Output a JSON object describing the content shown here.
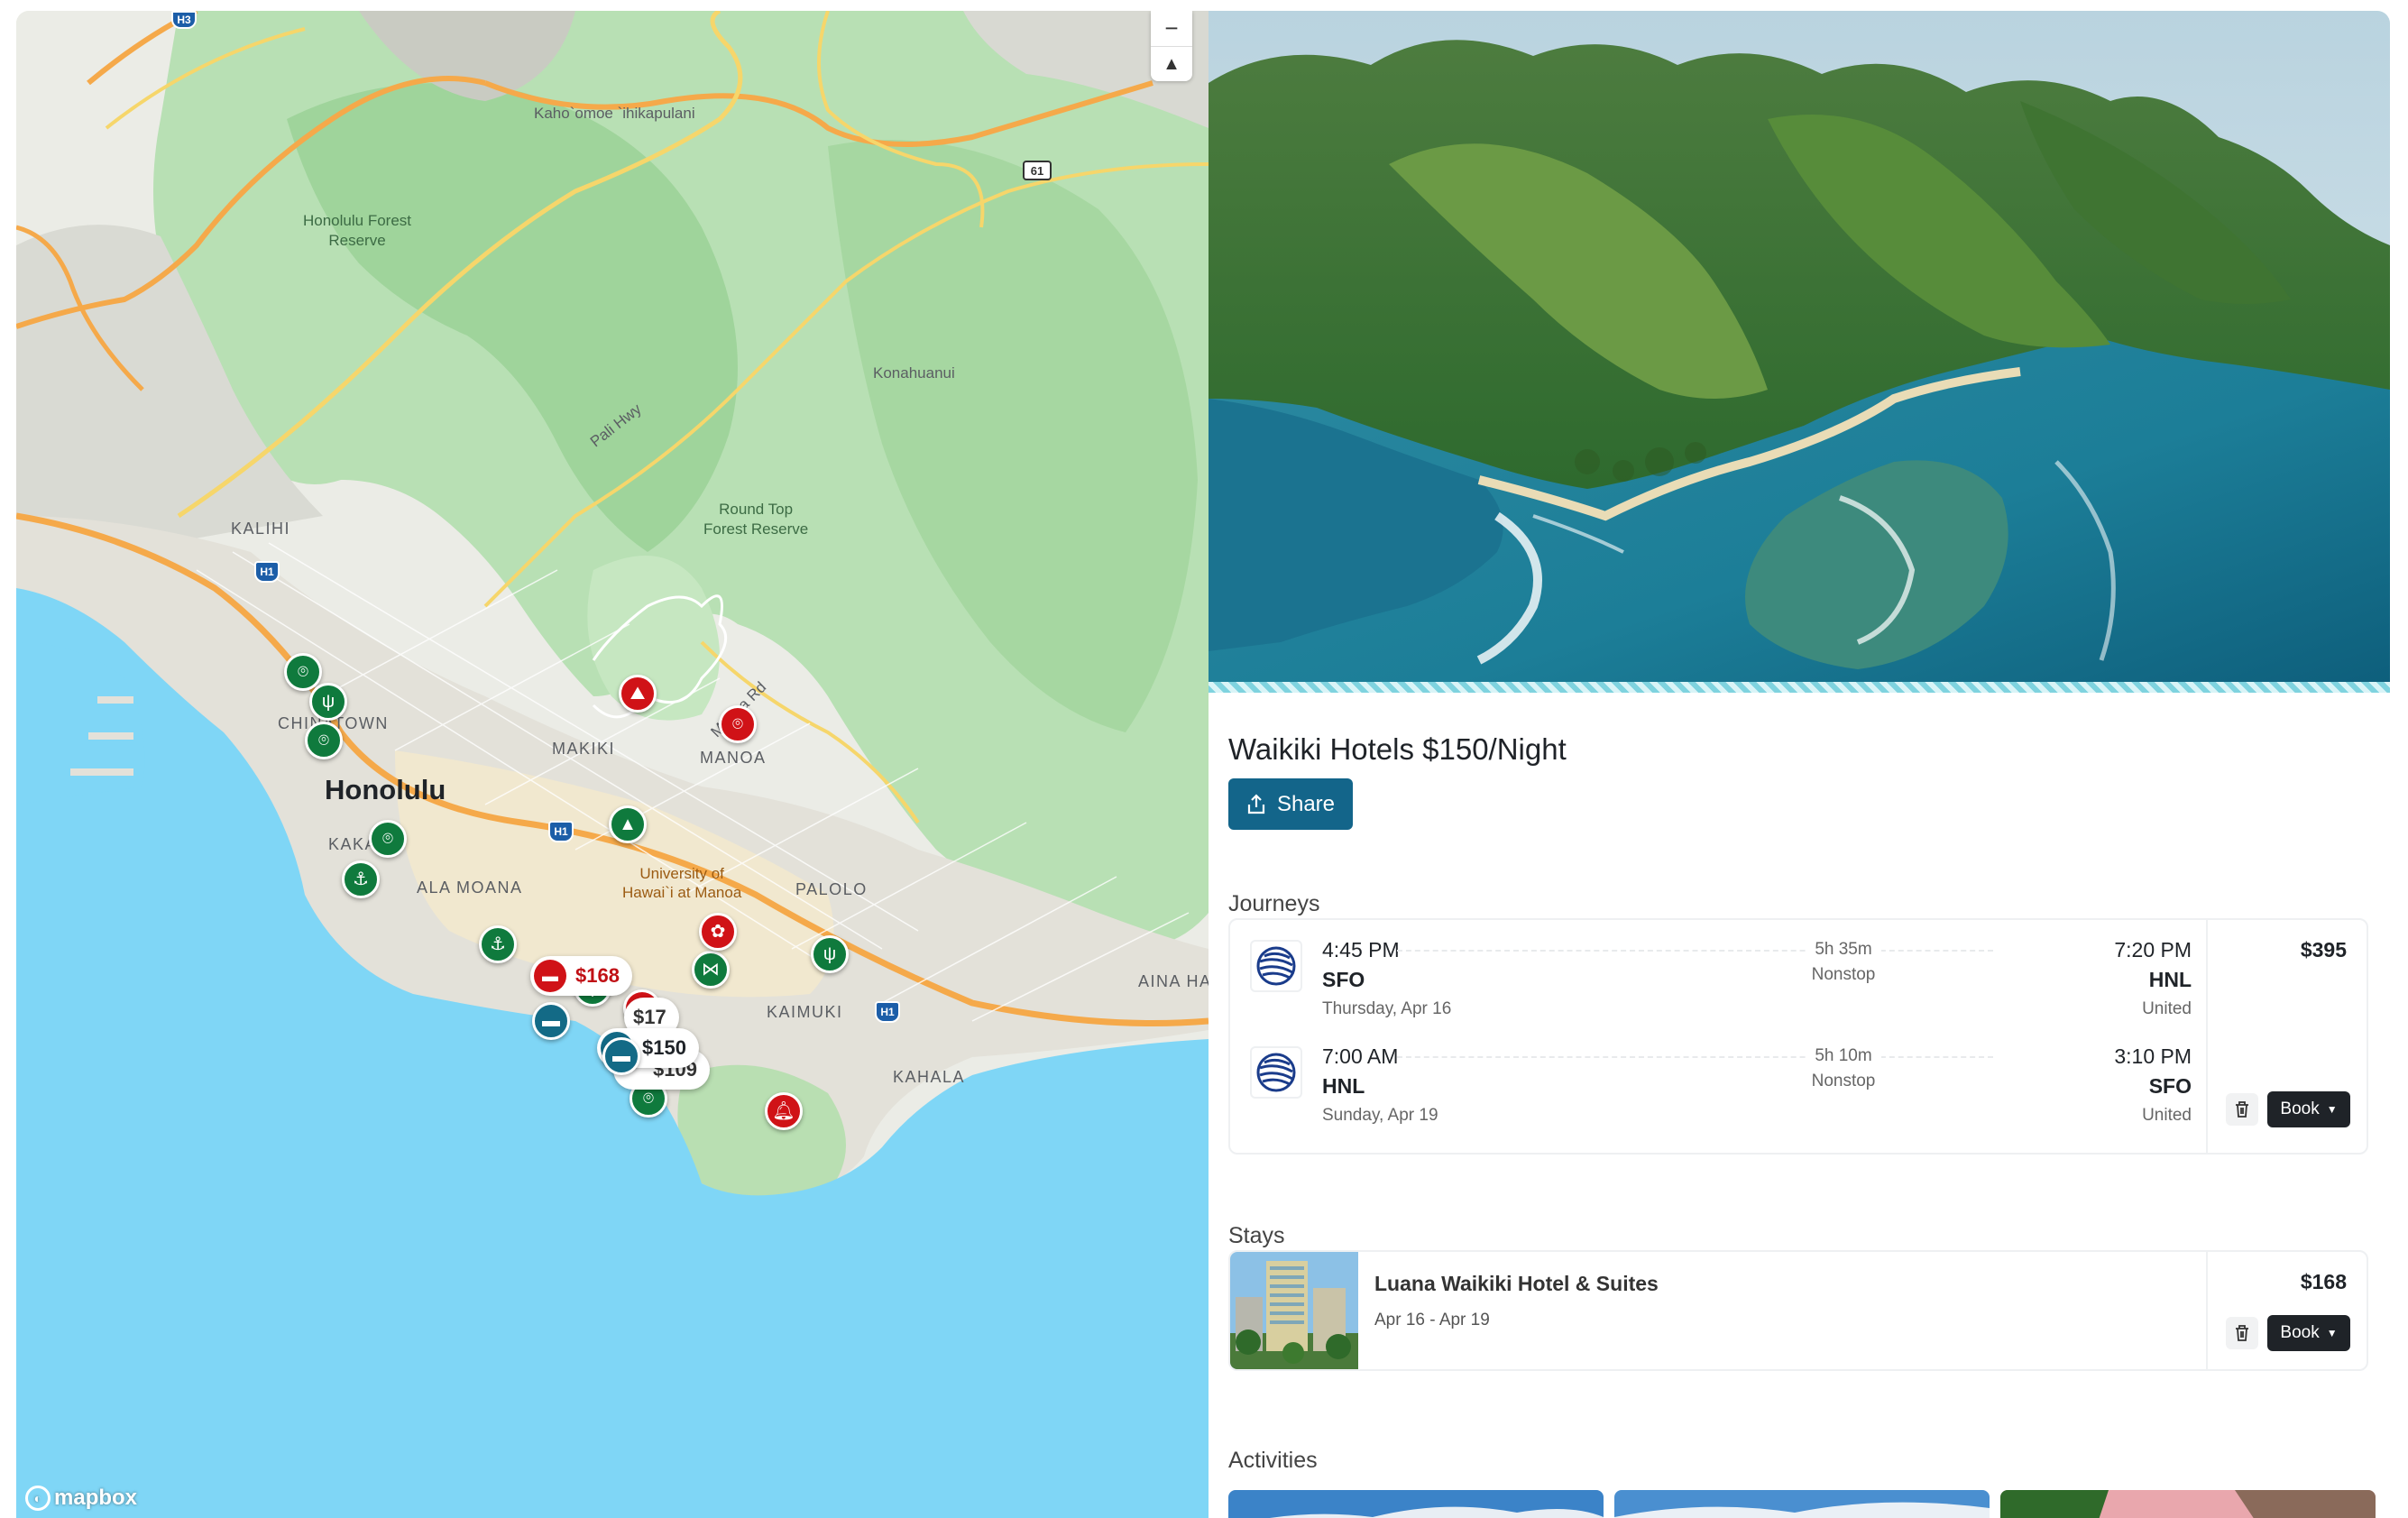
{
  "map": {
    "labels": {
      "honolulu": "Honolulu",
      "kalihi": "KALIHI",
      "chinatown": "CHINATOWN",
      "kakaako": "KAKA",
      "ala_moana": "ALA MOANA",
      "makiki": "MAKIKI",
      "manoa": "MANOA",
      "palolo": "PALOLO",
      "kaimuki": "KAIMUKI",
      "kahala": "KAHALA",
      "aina_haina": "AINA HA",
      "kahoomoe": "Kaho`omoe `ihikapulani",
      "konahuanui": "Konahuanui",
      "honolulu_forest": "Honolulu Forest\nReserve",
      "round_top": "Round Top\nForest Reserve",
      "pali_hwy": "Pali Hwy",
      "manoa_rd": "Manoa Rd",
      "university": "University of\nHawai`i at Manoa",
      "h1_a": "H1",
      "h1_b": "H1",
      "h1_c": "H1",
      "h3": "H3",
      "r61": "61"
    },
    "price_pins": {
      "p168": "$168",
      "p150": "$150",
      "p109": "$109",
      "p_partial": "$17"
    },
    "controls": {
      "zoom_out": "−",
      "compass": "▲"
    },
    "attribution": "mapbox"
  },
  "trip": {
    "title": "Waikiki Hotels $150/Night",
    "share_label": "Share"
  },
  "sections": {
    "journeys": "Journeys",
    "stays": "Stays",
    "activities": "Activities"
  },
  "journey": {
    "price": "$395",
    "book_label": "Book",
    "legs": [
      {
        "dep_time": "4:45 PM",
        "dep_code": "SFO",
        "dep_date": "Thursday, Apr 16",
        "duration": "5h 35m",
        "stops": "Nonstop",
        "arr_time": "7:20 PM",
        "arr_code": "HNL",
        "carrier": "United"
      },
      {
        "dep_time": "7:00 AM",
        "dep_code": "HNL",
        "dep_date": "Sunday, Apr 19",
        "duration": "5h 10m",
        "stops": "Nonstop",
        "arr_time": "3:10 PM",
        "arr_code": "SFO",
        "carrier": "United"
      }
    ]
  },
  "stay": {
    "name": "Luana Waikiki Hotel & Suites",
    "dates": "Apr 16 - Apr 19",
    "price": "$168",
    "book_label": "Book"
  },
  "colors": {
    "primary": "#13658a",
    "pin_green": "#0f7a3d",
    "pin_red": "#d01217",
    "pin_blue": "#136a86",
    "ocean": "#7fd6f6"
  },
  "icons": [
    "share-icon",
    "trash-icon",
    "chevron-down-icon",
    "bed-icon",
    "fork-knife-icon",
    "location-pin-icon",
    "anchor-icon",
    "mountain-icon",
    "tree-icon",
    "fish-icon",
    "bell-icon",
    "plus-icon",
    "compass-icon"
  ]
}
